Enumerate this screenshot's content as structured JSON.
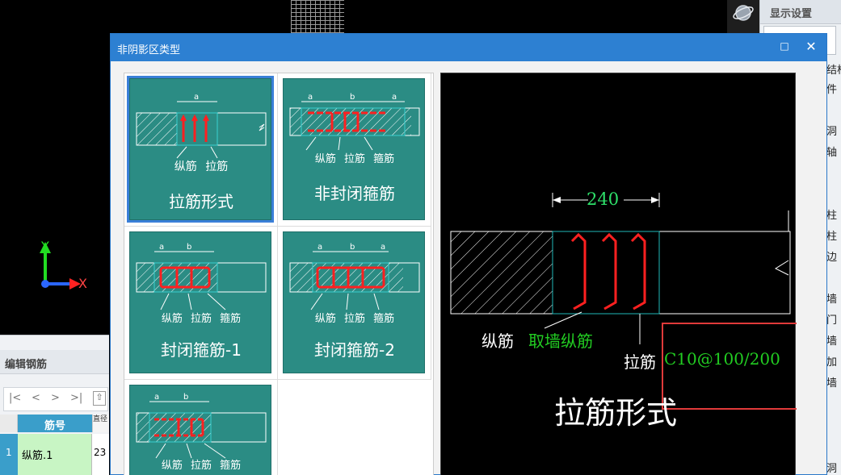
{
  "viewport": {
    "axis": {
      "y_label": "Y",
      "x_label": "X"
    }
  },
  "right_panel": {
    "title": "显示设置",
    "items": [
      "结构",
      "件",
      "",
      "洞",
      "轴",
      "",
      "柱",
      "柱",
      "边",
      "",
      "墙",
      "门",
      "墙",
      "加",
      "墙",
      "",
      "",
      "",
      "",
      "洞",
      "",
      ""
    ]
  },
  "rebar_editor": {
    "title": "编辑钢筋",
    "nav": [
      "|<",
      "<",
      ">",
      ">|"
    ],
    "columns": {
      "name": "筋号",
      "extra": "直径"
    },
    "rows": [
      {
        "index": "1",
        "name": "纵筋.1",
        "value": "23"
      }
    ]
  },
  "dialog": {
    "title": "非阴影区类型",
    "maximize": "□",
    "close": "✕",
    "tiles": [
      {
        "caption": "拉筋形式",
        "labels": [
          "纵筋",
          "拉筋"
        ],
        "dims": "a",
        "selected": true
      },
      {
        "caption": "非封闭箍筋",
        "labels": [
          "纵筋",
          "拉筋",
          "箍筋"
        ],
        "dims": "a b a"
      },
      {
        "caption": "封闭箍筋-1",
        "labels": [
          "纵筋",
          "拉筋",
          "箍筋"
        ],
        "dims": "a b"
      },
      {
        "caption": "封闭箍筋-2",
        "labels": [
          "纵筋",
          "拉筋",
          "箍筋"
        ],
        "dims": "a b a"
      },
      {
        "caption": "",
        "labels": [
          "纵筋",
          "拉筋",
          "箍筋"
        ],
        "dims": "a b"
      }
    ],
    "preview": {
      "dimension": "240",
      "longitudinal_label": "纵筋",
      "longitudinal_value": "取墙纵筋",
      "tie_label": "拉筋",
      "tie_value": "C10@100/200",
      "caption": "拉筋形式",
      "colors": {
        "value_green": "#22cc22",
        "highlight_red": "#e03a3a",
        "rebar_red": "#ff2020",
        "cyan": "#1fb8b8"
      }
    }
  }
}
